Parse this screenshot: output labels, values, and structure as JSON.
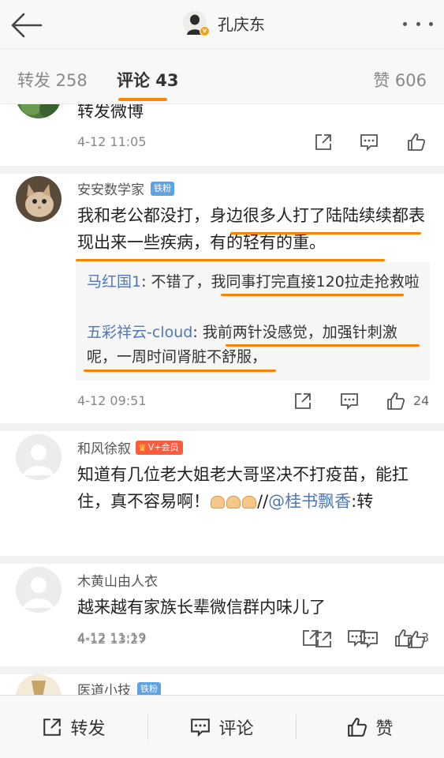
{
  "header": {
    "author_name": "孔庆东",
    "verified_mark": "v"
  },
  "tabs": {
    "repost": "转发 258",
    "comment": "评论 43",
    "like": "赞 606"
  },
  "comments": [
    {
      "text": "转发微博",
      "time": "4-12 11:05"
    },
    {
      "user": "安安数学家",
      "badge": "铁粉",
      "text": "我和老公都没打，身边很多人打了陆陆续续都表现出来一些疾病，有的轻有的重。",
      "replies": [
        {
          "name": "马红国1",
          "text": ": 不错了，我同事打完直接120拉走抢救啦"
        },
        {
          "name": "五彩祥云-cloud",
          "text": ": 我前两针没感觉，加强针刺激呢，一周时间肾脏不舒服，"
        }
      ],
      "time": "4-12 09:51",
      "likes": "24"
    },
    {
      "user": "和风徐叙",
      "badge": "V+会员",
      "text_part1": "知道有几位老大姐老大哥坚决不打疫苗，能扛住，真不容易啊！",
      "text_part2": "//",
      "mention": "@桂书飘香",
      "text_part3": ":转",
      "time": "4-12 11:19",
      "likes": "3"
    },
    {
      "user": "木黄山由人衣",
      "text": "越来越有家族长辈微信群内味儿了",
      "time": "4-12 13:27"
    },
    {
      "user": "医道小技",
      "badge": "铁粉"
    }
  ],
  "bottom_bar": {
    "repost": "转发",
    "comment": "评论",
    "like": "赞"
  },
  "colors": {
    "accent": "#ff8200",
    "link": "#5078b4",
    "fan_badge": "#5ea2e0",
    "vip_badge": "#ff5b3c"
  }
}
